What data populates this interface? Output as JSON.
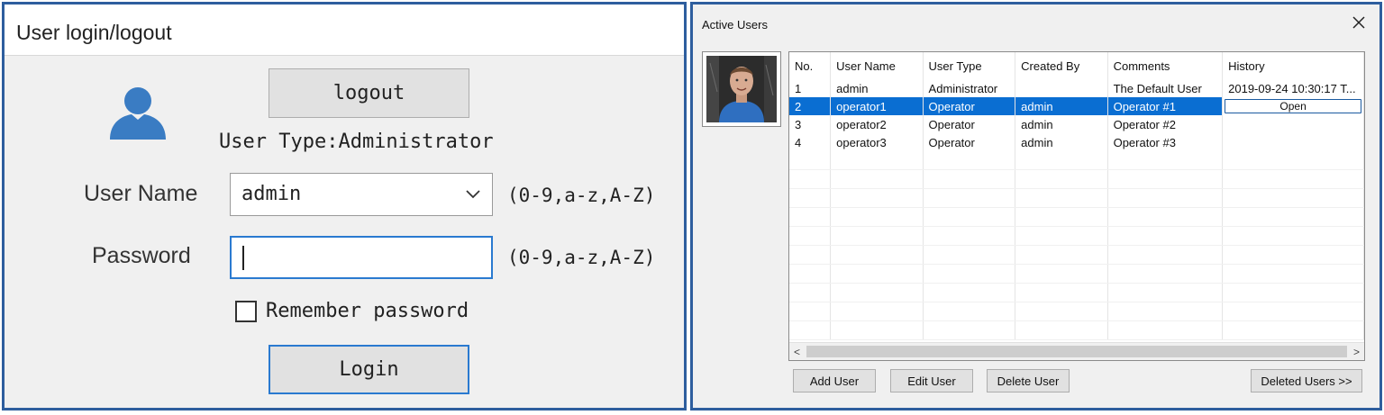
{
  "login_dialog": {
    "title": "User login/logout",
    "logout_label": "logout",
    "user_type_text": "User Type:Administrator",
    "username_label": "User Name",
    "username_value": "admin",
    "username_hint": "(0-9,a-z,A-Z)",
    "password_label": "Password",
    "password_hint": "(0-9,a-z,A-Z)",
    "remember_label": "Remember password",
    "remember_checked": false,
    "login_label": "Login",
    "accent_color": "#2a7ad0",
    "avatar_color": "#3a7cc3"
  },
  "users_dialog": {
    "title": "Active Users",
    "close_symbol": "✕",
    "columns": [
      "No.",
      "User Name",
      "User Type",
      "Created By",
      "Comments",
      "History"
    ],
    "rows": [
      {
        "no": "1",
        "user_name": "admin",
        "user_type": "Administrator",
        "created_by": "",
        "comments": "The Default User",
        "history": "2019-09-24 10:30:17 T..."
      },
      {
        "no": "2",
        "user_name": "operator1",
        "user_type": "Operator",
        "created_by": "admin",
        "comments": "Operator #1",
        "history": "Open",
        "selected": true
      },
      {
        "no": "3",
        "user_name": "operator2",
        "user_type": "Operator",
        "created_by": "admin",
        "comments": "Operator #2",
        "history": ""
      },
      {
        "no": "4",
        "user_name": "operator3",
        "user_type": "Operator",
        "created_by": "admin",
        "comments": "Operator #3",
        "history": ""
      }
    ],
    "scroll_left_symbol": "<",
    "scroll_right_symbol": ">",
    "buttons": {
      "add_user": "Add User",
      "edit_user": "Edit User",
      "delete_user": "Delete User",
      "deleted_users": "Deleted Users >>"
    },
    "selection_color": "#0a6ed2"
  }
}
